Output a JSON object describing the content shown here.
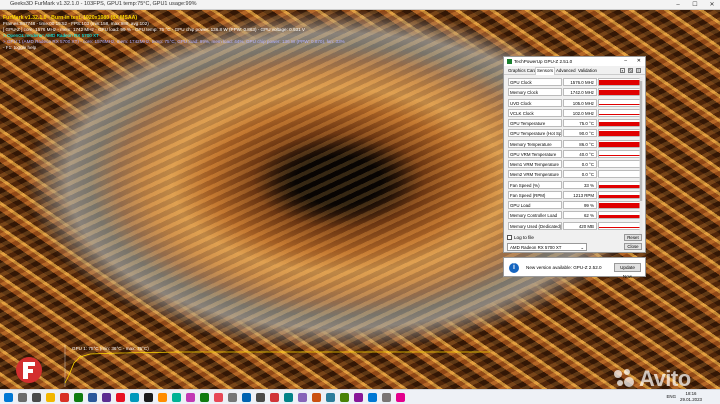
{
  "furmark": {
    "window_title": "Geeks3D FurMark v1.32.1.0 - 103FPS, GPU1 temp:75°C, GPU1 usage:99%",
    "overlay": {
      "line1": "FurMark v1.32.1.0 - Burn-in test, 1920x1080 (8X MSAA)",
      "line2": "Frames:987748 - time:00:19:52 - FPS:103 (min:158, max:989, avg:102)",
      "line3": "[ GPU-Z ] core: 1576 MHz - mem: 1742 MHz - GPU load: 99 % - GPU temp: 75 °C - GPU chip power: 136.8 W (PPW: 0.863) - GPU voltage: 0.931 V",
      "line4": "> OpenGL renderer: AMD Radeon RX 5700 XT",
      "line5": "> GPU 1 (AMD Radeon RX 5700 XT) - core: 1576MHz, mem: 1742MHz, temp: 75°C, GPU load: 99%, mem load: 44%, GPU chip power: 136 W (PPW: 0.870), fan: 33%",
      "line6": "- F1: toggle help"
    },
    "graph_label": "GPU 1: 75°C (min: 36°C - max: 75°C)"
  },
  "gpuz": {
    "title": "TechPowerUp GPU-Z 2.51.0",
    "tabs": [
      "Graphics Card",
      "Sensors",
      "Advanced",
      "Validation"
    ],
    "active_tab": "Sensors",
    "sensors": [
      {
        "name": "GPU Clock",
        "value": "1576.0 MHz",
        "level": 0.9
      },
      {
        "name": "Memory Clock",
        "value": "1742.0 MHz",
        "level": 0.85
      },
      {
        "name": "UVD Clock",
        "value": "105.0 MHz",
        "level": 0.05
      },
      {
        "name": "VCLK Clock",
        "value": "102.0 MHz",
        "level": 0.05
      },
      {
        "name": "GPU Temperature",
        "value": "75.0 °C",
        "level": 0.75
      },
      {
        "name": "GPU Temperature (Hot Spot)",
        "value": "90.0 °C",
        "level": 0.8
      },
      {
        "name": "Memory Temperature",
        "value": "86.0 °C",
        "level": 0.78
      },
      {
        "name": "GPU VRM Temperature",
        "value": "40.0 °C",
        "level": 0.05
      },
      {
        "name": "Mem1 VRM Temperature",
        "value": "0.0 °C",
        "level": 0
      },
      {
        "name": "Mem2 VRM Temperature",
        "value": "0.0 °C",
        "level": 0
      },
      {
        "name": "Fan Speed (%)",
        "value": "33 %",
        "level": 0.35
      },
      {
        "name": "Fan Speed (RPM)",
        "value": "1213 RPM",
        "level": 0.4
      },
      {
        "name": "GPU Load",
        "value": "99 %",
        "level": 0.9
      },
      {
        "name": "Memory Controller Load",
        "value": "62 %",
        "level": 0.6
      },
      {
        "name": "Memory Used (Dedicated)",
        "value": "420 MB",
        "level": 0.1
      }
    ],
    "log_to_file": "Log to file",
    "reset_label": "Reset",
    "close_label": "Close",
    "gpu_select": "AMD Radeon RX 5700 XT",
    "colors": {
      "graph": "#e00000"
    }
  },
  "notification": {
    "message": "New version available: GPU-Z 2.52.0",
    "button": "Update Now"
  },
  "watermark": "Avito",
  "taskbar": {
    "lang": "ENG",
    "time": "18:16",
    "date": "29.01.2023"
  }
}
